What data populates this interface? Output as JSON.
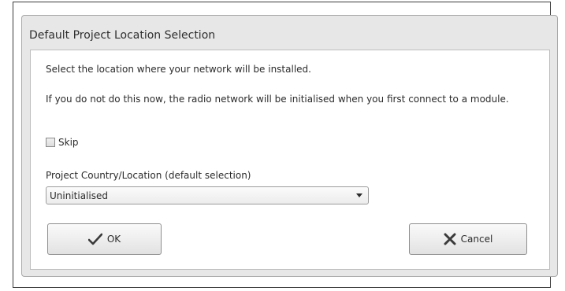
{
  "dialog": {
    "title": "Default Project Location Selection",
    "line1": "Select the location where your network will be installed.",
    "line2": "If you do not do this now, the radio network will be initialised when you first connect to a module.",
    "skip": {
      "label": "Skip",
      "checked": false
    },
    "location": {
      "label": "Project Country/Location  (default selection)",
      "selected": "Uninitialised"
    },
    "buttons": {
      "ok": "OK",
      "cancel": "Cancel"
    }
  },
  "icons": {
    "ok": "check-icon",
    "cancel": "x-icon",
    "dropdown": "chevron-down-icon"
  }
}
